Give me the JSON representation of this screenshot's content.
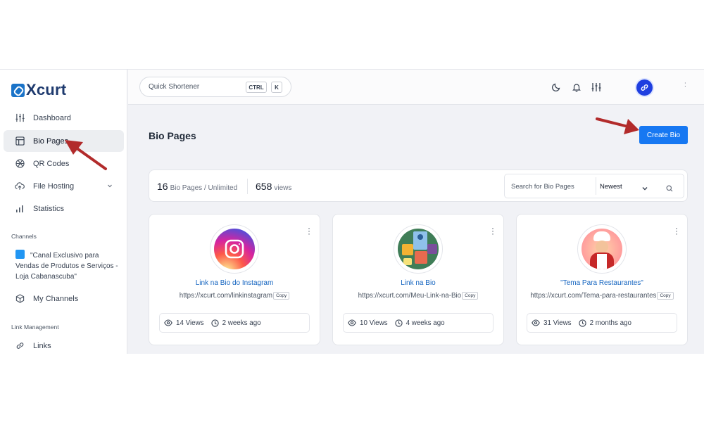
{
  "brand": {
    "name": "Xcurt"
  },
  "sidebar": {
    "items": [
      {
        "label": "Dashboard",
        "icon": "sliders-icon"
      },
      {
        "label": "Bio Pages",
        "icon": "layout-icon",
        "active": true
      },
      {
        "label": "QR Codes",
        "icon": "aperture-icon"
      },
      {
        "label": "File Hosting",
        "icon": "cloud-upload-icon"
      },
      {
        "label": "Statistics",
        "icon": "bar-chart-icon"
      }
    ],
    "channels_label": "Channels",
    "channel_name": "\"Canal Exclusivo para Vendas de Produtos e Serviços - Loja Cabanascuba\"",
    "my_channels": "My Channels",
    "link_management_label": "Link Management",
    "links": "Links"
  },
  "topbar": {
    "search_label": "Quick Shortener",
    "kbd_ctrl": "CTRL",
    "kbd_k": "K",
    "user_trailing": ":"
  },
  "main": {
    "title": "Bio Pages",
    "create_button": "Create Bio",
    "stats": {
      "pages_count": "16",
      "pages_label": "Bio Pages / Unlimited",
      "views_count": "658",
      "views_label": "views"
    },
    "search_placeholder": "Search for Bio Pages",
    "sort_selected": "Newest"
  },
  "cards": [
    {
      "name": "Link na Bio do Instagram",
      "url": "https://xcurt.com/linkinstagram",
      "copy": "Copy",
      "views": "14 Views",
      "age": "2 weeks ago"
    },
    {
      "name": "Link na Bio",
      "url": "https://xcurt.com/Meu-Link-na-Bio",
      "copy": "Copy",
      "views": "10 Views",
      "age": "4 weeks ago"
    },
    {
      "name": "\"Tema Para Restaurantes\"",
      "url": "https://xcurt.com/Tema-para-restaurantes",
      "copy": "Copy",
      "views": "31 Views",
      "age": "2 months ago"
    }
  ],
  "colors": {
    "primary": "#1778f2",
    "annotation_arrow": "#b22b2b"
  }
}
